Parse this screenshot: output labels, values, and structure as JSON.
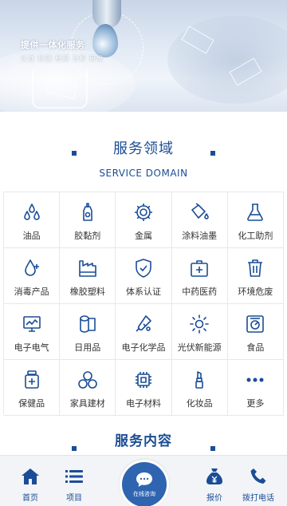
{
  "banner": {
    "title": "提供一体化服务",
    "subtitle": "认证  检测  检测  分析  研发"
  },
  "service_domain": {
    "title": "服务领域",
    "subtitle": "SERVICE DOMAIN",
    "items": [
      {
        "label": "油品",
        "icon": "oil-drops-icon"
      },
      {
        "label": "胶黏剂",
        "icon": "adhesive-bottle-icon"
      },
      {
        "label": "金属",
        "icon": "gear-icon"
      },
      {
        "label": "涂料油墨",
        "icon": "paint-bucket-icon"
      },
      {
        "label": "化工助剂",
        "icon": "flask-icon"
      },
      {
        "label": "消毒产品",
        "icon": "disinfect-drop-icon"
      },
      {
        "label": "橡胶塑料",
        "icon": "factory-icon"
      },
      {
        "label": "体系认证",
        "icon": "shield-check-icon"
      },
      {
        "label": "中药医药",
        "icon": "medical-kit-icon"
      },
      {
        "label": "环境危废",
        "icon": "trash-bin-icon"
      },
      {
        "label": "电子电气",
        "icon": "monitor-icon"
      },
      {
        "label": "日用品",
        "icon": "tissue-roll-icon"
      },
      {
        "label": "电子化学品",
        "icon": "test-tubes-icon"
      },
      {
        "label": "光伏新能源",
        "icon": "sun-icon"
      },
      {
        "label": "食品",
        "icon": "food-scale-icon"
      },
      {
        "label": "保健品",
        "icon": "supplement-jar-icon"
      },
      {
        "label": "家具建材",
        "icon": "circles-icon"
      },
      {
        "label": "电子材料",
        "icon": "chip-icon"
      },
      {
        "label": "化妆品",
        "icon": "lipstick-icon"
      },
      {
        "label": "更多",
        "icon": "more-dots-icon"
      }
    ]
  },
  "service_content": {
    "title": "服务内容"
  },
  "bottom_nav": {
    "home": "首页",
    "projects": "项目",
    "consult": "在线咨询",
    "price": "报价",
    "call": "拨打电话"
  },
  "colors": {
    "accent": "#1b4d96",
    "center_button": "#2f64b0",
    "icon_stroke": "#1b4d96"
  }
}
